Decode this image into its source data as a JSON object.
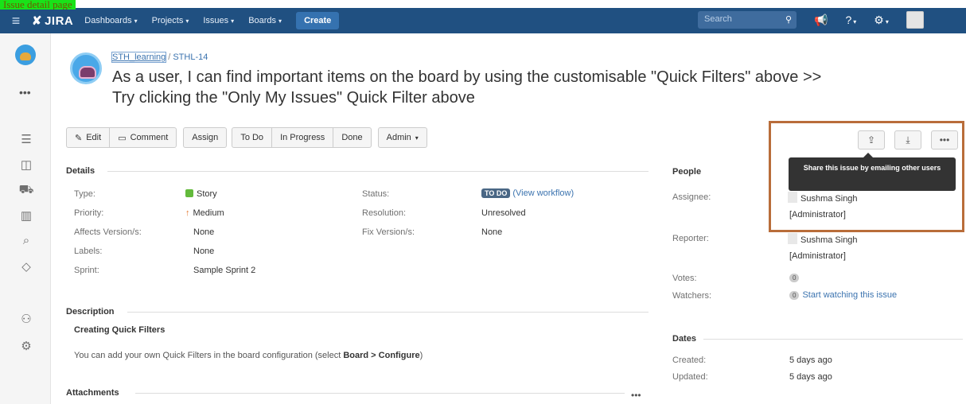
{
  "caption": "Issue detail page",
  "nav": {
    "logo": "JIRA",
    "items": [
      "Dashboards",
      "Projects",
      "Issues",
      "Boards"
    ],
    "create": "Create",
    "search_placeholder": "Search"
  },
  "breadcrumb": {
    "project": "STH_learning",
    "separator": "/",
    "issue_key": "STHL-14"
  },
  "summary": "As a user, I can find important items on the board by using the customisable \"Quick Filters\" above >> Try clicking the \"Only My Issues\" Quick Filter above",
  "toolbar": {
    "edit": "Edit",
    "comment": "Comment",
    "assign": "Assign",
    "todo": "To Do",
    "in_progress": "In Progress",
    "done": "Done",
    "admin": "Admin"
  },
  "details": {
    "title": "Details",
    "type_label": "Type:",
    "type_value": "Story",
    "priority_label": "Priority:",
    "priority_value": "Medium",
    "affects_label": "Affects Version/s:",
    "affects_value": "None",
    "labels_label": "Labels:",
    "labels_value": "None",
    "sprint_label": "Sprint:",
    "sprint_value": "Sample Sprint 2",
    "status_label": "Status:",
    "status_lozenge": "TO DO",
    "status_link": "(View workflow)",
    "resolution_label": "Resolution:",
    "resolution_value": "Unresolved",
    "fix_label": "Fix Version/s:",
    "fix_value": "None"
  },
  "description": {
    "title": "Description",
    "subtitle": "Creating Quick Filters",
    "text_before": "You can add your own Quick Filters in the board configuration (select ",
    "text_bold": "Board > Configure",
    "text_after": ")"
  },
  "attachments": {
    "title": "Attachments",
    "more": "•••"
  },
  "people": {
    "title": "People",
    "assignee_label": "Assignee:",
    "assignee_name": "Sushma Singh",
    "assignee_role": "[Administrator]",
    "reporter_label": "Reporter:",
    "reporter_name": "Sushma Singh",
    "reporter_role": "[Administrator]",
    "votes_label": "Votes:",
    "votes_count": "0",
    "watchers_label": "Watchers:",
    "watchers_count": "0",
    "watch_link": "Start watching this issue"
  },
  "dates": {
    "title": "Dates",
    "created_label": "Created:",
    "created_value": "5 days ago",
    "updated_label": "Updated:",
    "updated_value": "5 days ago"
  },
  "tooltip": "Share this issue by emailing other users",
  "colors": {
    "nav_bg": "#205081",
    "link": "#3b73af",
    "highlight": "#b96d3a",
    "caption_bg": "#19e219"
  }
}
